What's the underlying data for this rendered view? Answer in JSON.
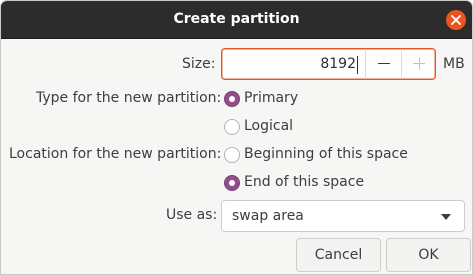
{
  "window": {
    "title": "Create partition",
    "close_icon": "close-icon",
    "close_color": "#e95420"
  },
  "size": {
    "label": "Size:",
    "value": "8192",
    "unit": "MB",
    "decrement_icon": "minus-icon",
    "increment_icon": "plus-icon"
  },
  "type": {
    "label": "Type for the new partition:",
    "options": [
      "Primary",
      "Logical"
    ],
    "selected": "Primary"
  },
  "location": {
    "label": "Location for the new partition:",
    "options": [
      "Beginning of this space",
      "End of this space"
    ],
    "selected": "End of this space"
  },
  "use_as": {
    "label": "Use as:",
    "value": "swap area"
  },
  "buttons": {
    "cancel": "Cancel",
    "ok": "OK"
  },
  "colors": {
    "accent": "#e95420",
    "radio_selected": "#924d8b",
    "titlebar": "#2c2c2c"
  }
}
